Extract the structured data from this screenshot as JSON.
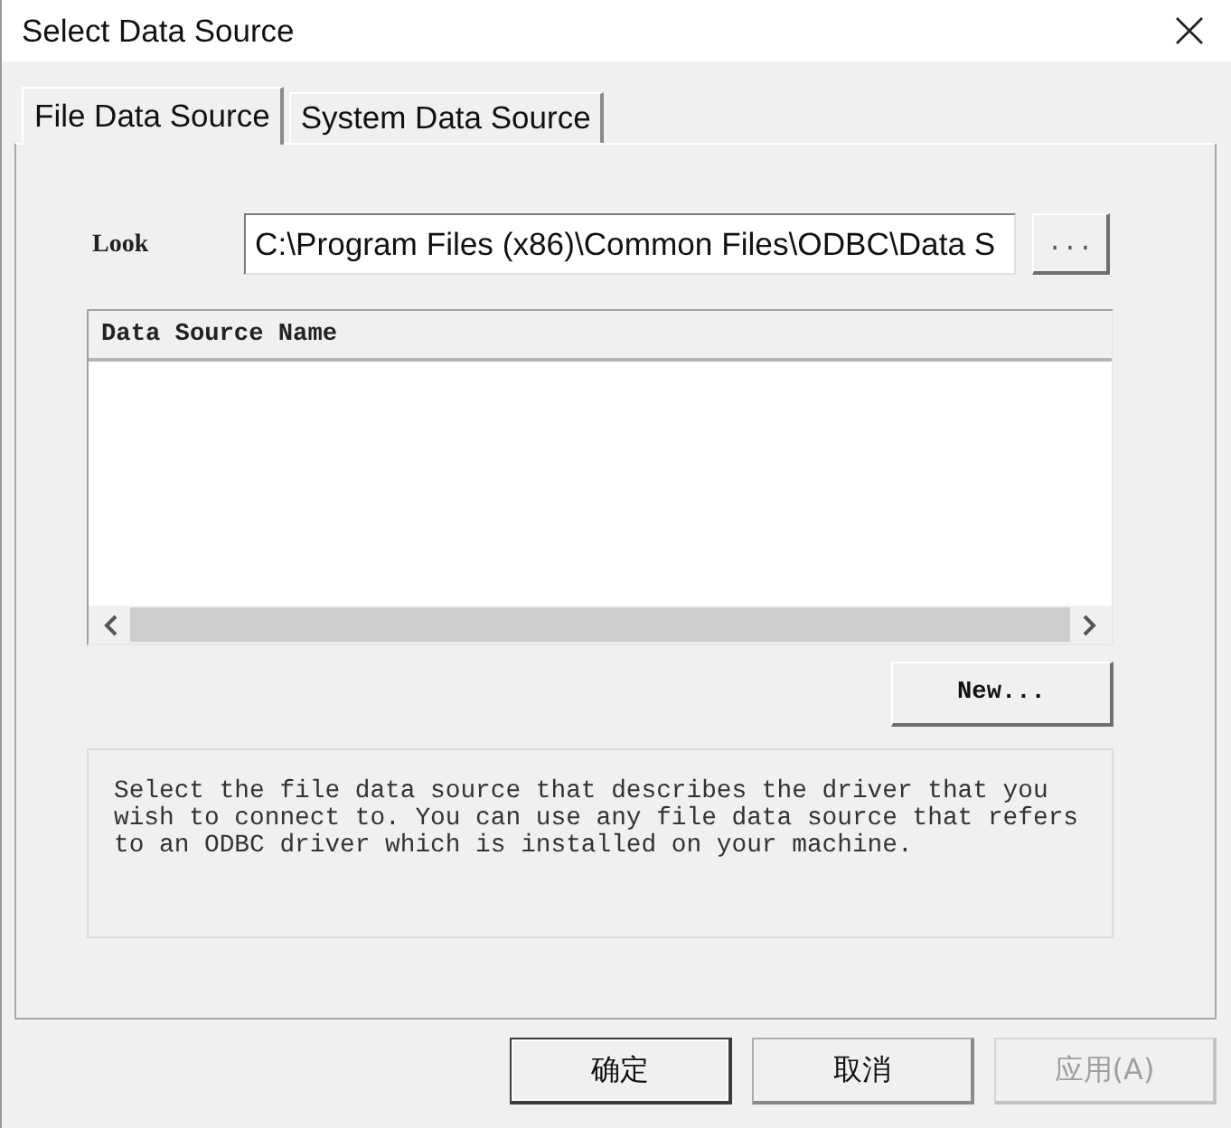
{
  "window": {
    "title": "Select Data Source"
  },
  "tabs": [
    {
      "label": "File Data Source",
      "selected": true
    },
    {
      "label": "System Data Source",
      "selected": false
    }
  ],
  "look_in": {
    "label": "Look",
    "value": "C:\\Program Files (x86)\\Common Files\\ODBC\\Data S",
    "browse_button": "..."
  },
  "list": {
    "columns": [
      "Data Source Name"
    ]
  },
  "new_button": "New...",
  "description": "Select the file data source that describes the driver that you wish to connect to. You can use any file data source that refers to an ODBC driver which is installed on your machine.",
  "buttons": [
    {
      "label": "确定",
      "default": true,
      "disabled": false
    },
    {
      "label": "取消",
      "default": false,
      "disabled": false
    },
    {
      "label": "应用(A)",
      "default": false,
      "disabled": true
    }
  ]
}
